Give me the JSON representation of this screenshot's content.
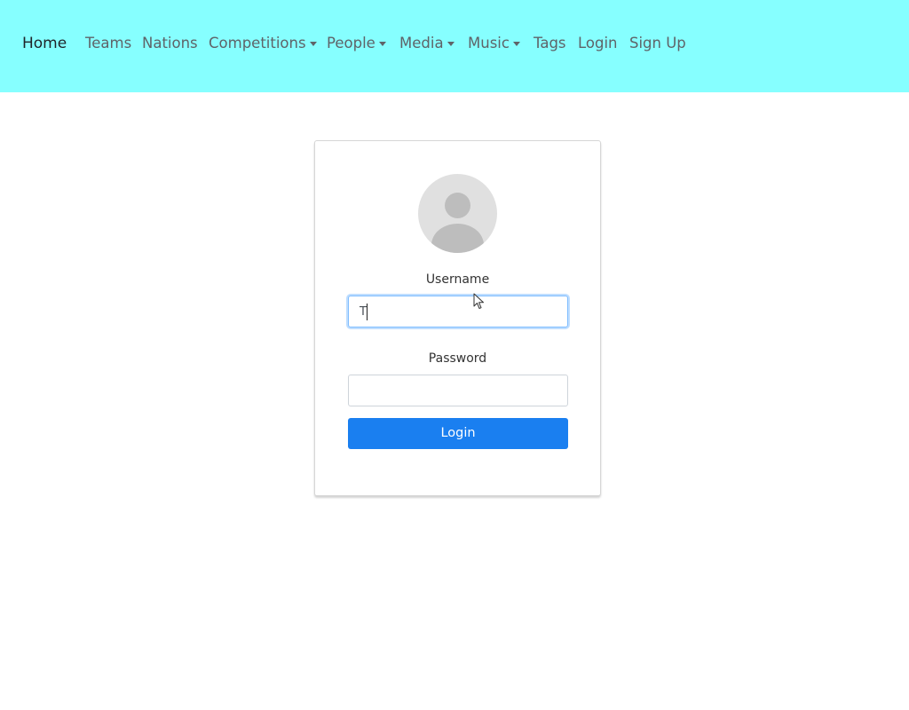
{
  "navbar": {
    "brand": "Home",
    "items": [
      {
        "label": "Teams",
        "dropdown": false
      },
      {
        "label": "Nations",
        "dropdown": false
      },
      {
        "label": "Competitions",
        "dropdown": true
      },
      {
        "label": "People",
        "dropdown": true
      },
      {
        "label": "Media",
        "dropdown": true
      },
      {
        "label": "Music",
        "dropdown": true
      },
      {
        "label": "Tags",
        "dropdown": false
      },
      {
        "label": "Login",
        "dropdown": false
      },
      {
        "label": "Sign Up",
        "dropdown": false
      }
    ],
    "background": "#86ffff"
  },
  "login_form": {
    "avatar_icon": "user-avatar-icon",
    "username_label": "Username",
    "username_value": "T",
    "password_label": "Password",
    "password_value": "",
    "submit_label": "Login",
    "accent": "#1a7ff0"
  }
}
